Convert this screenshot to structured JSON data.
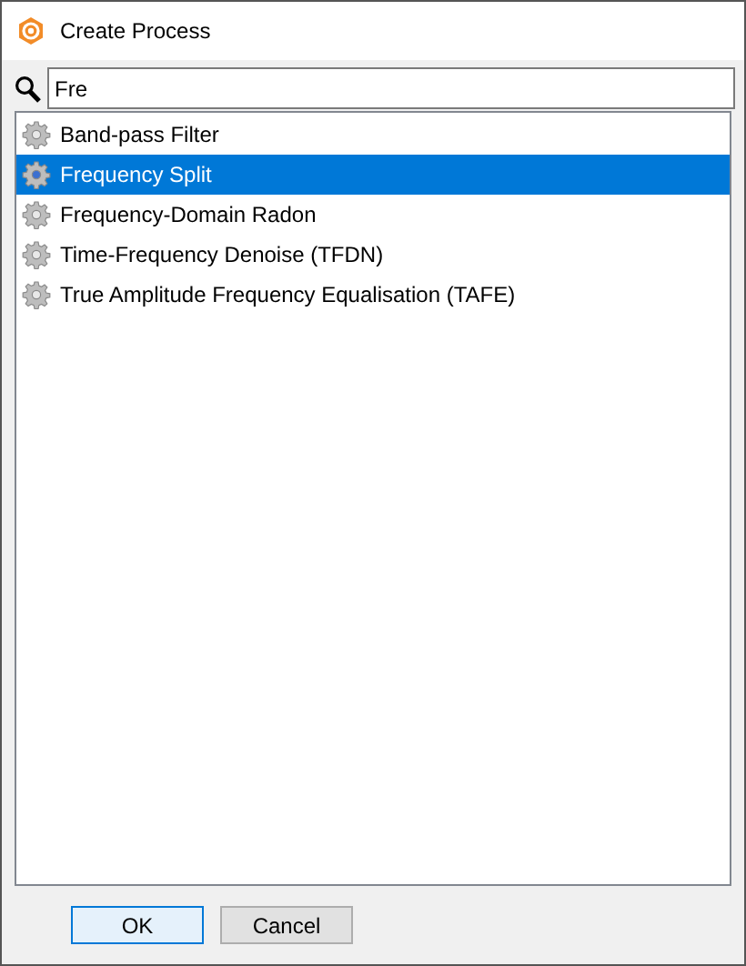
{
  "window": {
    "title": "Create Process"
  },
  "search": {
    "value": "Fre"
  },
  "processes": [
    {
      "label": "Band-pass Filter",
      "selected": false
    },
    {
      "label": "Frequency Split",
      "selected": true
    },
    {
      "label": "Frequency-Domain Radon",
      "selected": false
    },
    {
      "label": "Time-Frequency Denoise (TFDN)",
      "selected": false
    },
    {
      "label": "True Amplitude Frequency Equalisation (TAFE)",
      "selected": false
    }
  ],
  "buttons": [
    {
      "label": "OK",
      "default": true
    },
    {
      "label": "Cancel",
      "default": false
    }
  ]
}
